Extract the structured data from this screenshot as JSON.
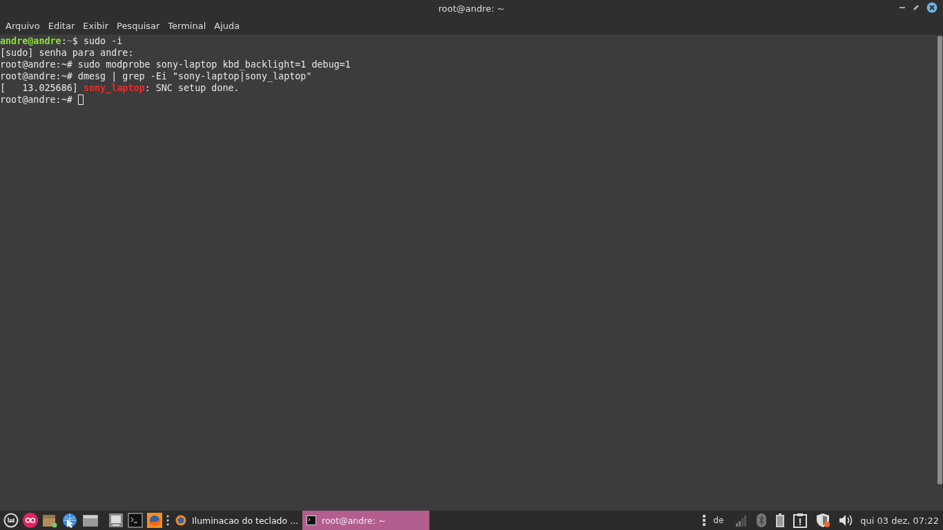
{
  "window": {
    "title": "root@andre: ~"
  },
  "menu": [
    "Arquivo",
    "Editar",
    "Exibir",
    "Pesquisar",
    "Terminal",
    "Ajuda"
  ],
  "terminal": {
    "lines": [
      {
        "segments": [
          {
            "text": "andre@andre",
            "kind": "user"
          },
          {
            "text": ":",
            "kind": "plain"
          },
          {
            "text": "~",
            "kind": "path"
          },
          {
            "text": "$ sudo -i",
            "kind": "plain"
          }
        ]
      },
      {
        "segments": [
          {
            "text": "[sudo] senha para andre:",
            "kind": "plain"
          }
        ]
      },
      {
        "segments": [
          {
            "text": "root@andre:~# sudo modprobe sony-laptop kbd_backlight=1 debug=1",
            "kind": "plain"
          }
        ]
      },
      {
        "segments": [
          {
            "text": "root@andre:~# dmesg | grep -Ei \"sony-laptop|sony_laptop\"",
            "kind": "plain"
          }
        ]
      },
      {
        "segments": [
          {
            "text": "[   13.025686] ",
            "kind": "plain"
          },
          {
            "text": "sony_laptop",
            "kind": "match"
          },
          {
            "text": ": SNC setup done.",
            "kind": "plain"
          }
        ]
      },
      {
        "segments": [
          {
            "text": "root@andre:~# ",
            "kind": "plain"
          }
        ],
        "cursor": true
      }
    ]
  },
  "taskbar": {
    "windows": [
      {
        "title": "Iluminacao do teclado ...",
        "kind": "browser",
        "selected": false
      },
      {
        "title": "root@andre: ~",
        "kind": "terminal",
        "selected": true
      }
    ],
    "keyboard_layout": "de",
    "clock": "qui 03 dez, 07:22"
  }
}
